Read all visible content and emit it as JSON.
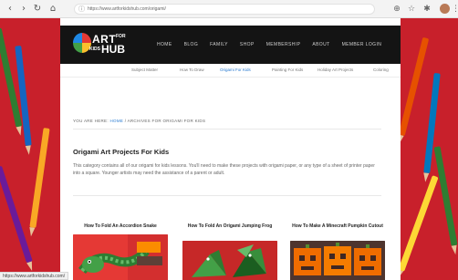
{
  "browser": {
    "url": "https://www.artforkidshub.com/origami/",
    "icons": [
      "back-icon",
      "forward-icon",
      "reload-icon",
      "home-icon",
      "lock-icon",
      "translate-icon",
      "star-icon",
      "extensions-icon",
      "profile-avatar",
      "menu-icon"
    ]
  },
  "site": {
    "logo": {
      "art": "ART",
      "for": "FOR",
      "kids": "KIDS",
      "hub": "HUB"
    },
    "main_nav": [
      "HOME",
      "BLOG",
      "FAMILY",
      "SHOP",
      "MEMBERSHIP",
      "ABOUT",
      "MEMBER LOGIN"
    ],
    "sub_nav": [
      "Subject Matter",
      "How To Draw",
      "Origami For Kids",
      "Painting For Kids",
      "Holiday Art Projects",
      "Coloring"
    ],
    "sub_nav_active_index": 2,
    "accent_color": "#2a7bd1"
  },
  "breadcrumb": {
    "prefix": "YOU ARE HERE: ",
    "home": "HOME",
    "separator": " / ",
    "current": "ARCHIVES FOR ORIGAMI FOR KIDS"
  },
  "page": {
    "title": "Origami Art Projects For Kids",
    "intro": "This category contains all of our origami for kids lessons. You'll need to make these projects with origami paper, or any type of a sheet of printer paper into a square. Younger artists may need the assistance of a parent or adult."
  },
  "cards": [
    {
      "title": "How To Fold An Accordion Snake"
    },
    {
      "title": "How To Fold An Origami Jumping Frog"
    },
    {
      "title": "How To Make A Minecraft Pumpkin Cutout"
    }
  ],
  "status_bar": {
    "text": "https://www.artforkidshub.com/"
  }
}
